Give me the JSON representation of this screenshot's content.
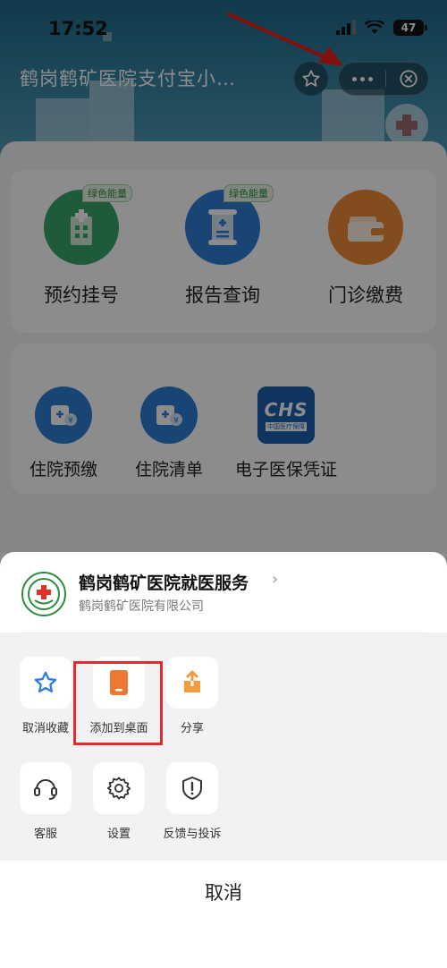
{
  "status": {
    "time": "17:52",
    "battery": "47"
  },
  "nav": {
    "title": "鹤岗鹤矿医院支付宝小…"
  },
  "services": [
    {
      "label": "预约挂号",
      "badge": "绿色能量",
      "color": "#3aa56a"
    },
    {
      "label": "报告查询",
      "badge": "绿色能量",
      "color": "#2f7fd6"
    },
    {
      "label": "门诊缴费",
      "badge": "",
      "color": "#ef8a38"
    }
  ],
  "services2": [
    {
      "label": "住院预缴"
    },
    {
      "label": "住院清单"
    },
    {
      "label": "电子医保凭证",
      "logo_text": "CHS",
      "logo_sub": "中国医疗保障"
    }
  ],
  "sheet": {
    "app_name": "鹤岗鹤矿医院就医服务",
    "company": "鹤岗鹤矿医院有限公司",
    "actions": [
      {
        "label": "取消收藏",
        "icon": "star-outline-icon"
      },
      {
        "label": "添加到桌面",
        "icon": "add-to-desktop-icon"
      },
      {
        "label": "分享",
        "icon": "share-icon"
      },
      {
        "label": "客服",
        "icon": "headset-icon"
      },
      {
        "label": "设置",
        "icon": "gear-icon"
      },
      {
        "label": "反馈与投诉",
        "icon": "shield-alert-icon"
      }
    ],
    "cancel_label": "取消"
  },
  "colors": {
    "accent_blue": "#2f7fd6",
    "highlight_red": "#e22b2b",
    "arrow_red": "#e8221b"
  }
}
